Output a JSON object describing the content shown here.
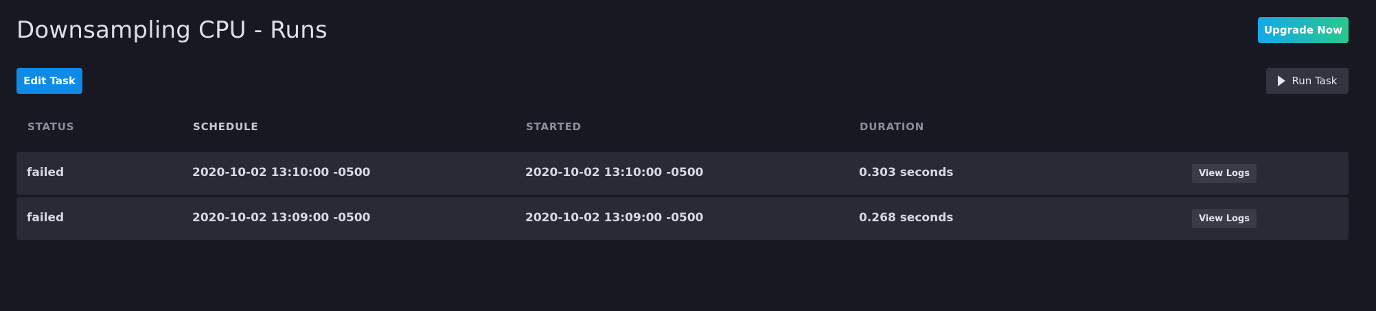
{
  "header": {
    "title": "Downsampling CPU - Runs",
    "upgrade_label": "Upgrade Now"
  },
  "toolbar": {
    "edit_label": "Edit Task",
    "run_label": "Run Task",
    "run_icon": "play-icon"
  },
  "table": {
    "columns": [
      "STATUS",
      "SCHEDULE",
      "STARTED",
      "DURATION"
    ],
    "rows": [
      {
        "status": "failed",
        "schedule": "2020-10-02 13:10:00 -0500",
        "started": "2020-10-02 13:10:00 -0500",
        "duration": "0.303 seconds",
        "action": "View Logs"
      },
      {
        "status": "failed",
        "schedule": "2020-10-02 13:09:00 -0500",
        "started": "2020-10-02 13:09:00 -0500",
        "duration": "0.268 seconds",
        "action": "View Logs"
      }
    ]
  },
  "colors": {
    "background": "#181822",
    "row": "#292a35",
    "primary": "#0d8be6",
    "upgrade_start": "#13a9e8",
    "upgrade_end": "#2ac78c"
  }
}
